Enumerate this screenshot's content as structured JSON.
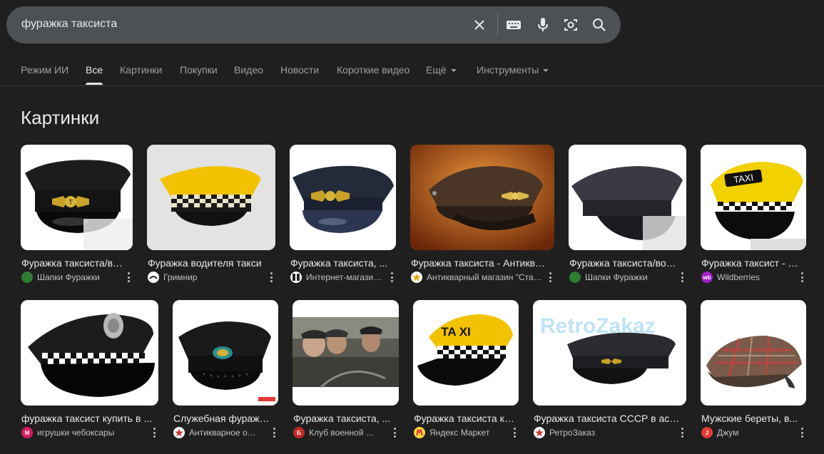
{
  "search": {
    "query": "фуражка таксиста"
  },
  "tabs": [
    {
      "label": "Режим ИИ"
    },
    {
      "label": "Все"
    },
    {
      "label": "Картинки"
    },
    {
      "label": "Покупки"
    },
    {
      "label": "Видео"
    },
    {
      "label": "Новости"
    },
    {
      "label": "Короткие видео"
    },
    {
      "label": "Ещё"
    },
    {
      "label": "Инструменты"
    }
  ],
  "section": {
    "title": "Картинки"
  },
  "results": [
    {
      "title": "Фуражка таксиста/водителя",
      "source": "Шапки Фуражки"
    },
    {
      "title": "Фуражка водителя такси",
      "source": "Гримнир"
    },
    {
      "title": "Фуражка таксиста, ...",
      "source": "Интернет-магазин..."
    },
    {
      "title": "Фуражка таксиста - Антикварный",
      "source": "Антикварный магазин \"Старина\""
    },
    {
      "title": "Фуражка таксиста/водителя",
      "source": "Шапки Фуражки"
    },
    {
      "title": "Фуражка таксист - Купить",
      "source": "Wildberries"
    },
    {
      "title": "фуражка таксист купить в ...",
      "source": "игрушки чебоксары"
    },
    {
      "title": "Служебная фуражка таксиста",
      "source": "Антикварное об..."
    },
    {
      "title": "Фуражка таксиста, ...",
      "source": "Клуб военной ..."
    },
    {
      "title": "Фуражка таксиста купить",
      "source": "Яндекс Маркет"
    },
    {
      "title": "Фуражка таксиста СССР в ассортименте",
      "source": "РетроЗаказ"
    },
    {
      "title": "Мужские береты, в...",
      "source": "Джум"
    }
  ],
  "thumb_text": {
    "taxi_1": "TAXI",
    "taxi_2": "TA XI",
    "watermark": "RetroZakaz"
  },
  "colors": {
    "background": "#1f1f1f",
    "searchbar": "#4d5156",
    "text": "#e8eaed",
    "muted": "#9aa0a6",
    "taxi_yellow": "#f2c200"
  }
}
